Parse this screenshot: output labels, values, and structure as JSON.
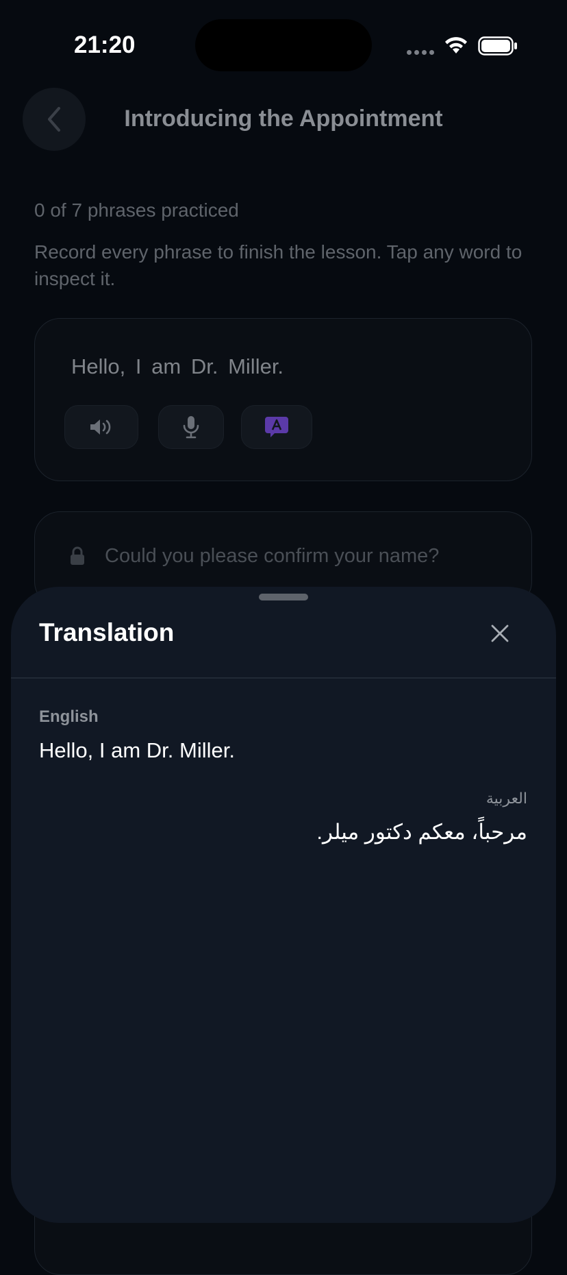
{
  "status_bar": {
    "time": "21:20"
  },
  "header": {
    "title": "Introducing the Appointment"
  },
  "lesson": {
    "progress": "0 of 7 phrases practiced",
    "instructions": "Record every phrase to finish the lesson. Tap any word to inspect it."
  },
  "phrases": {
    "current": {
      "words": [
        "Hello,",
        "I",
        "am",
        "Dr.",
        "Miller."
      ]
    },
    "locked": {
      "text": "Could you please confirm your name?"
    }
  },
  "icons": {
    "play": "speaker-icon",
    "record": "microphone-icon",
    "translate": "translate-bubble-icon",
    "lock": "lock-icon",
    "close": "close-icon",
    "back": "chevron-left-icon"
  },
  "colors": {
    "translate_accent": "#5b3aa8",
    "sheet_bg": "#111824"
  },
  "translation_sheet": {
    "title": "Translation",
    "source_label": "English",
    "source_text": "Hello, I am Dr. Miller.",
    "target_label": "العربية",
    "target_text": "مرحباً، معكم دكتور ميلر."
  }
}
